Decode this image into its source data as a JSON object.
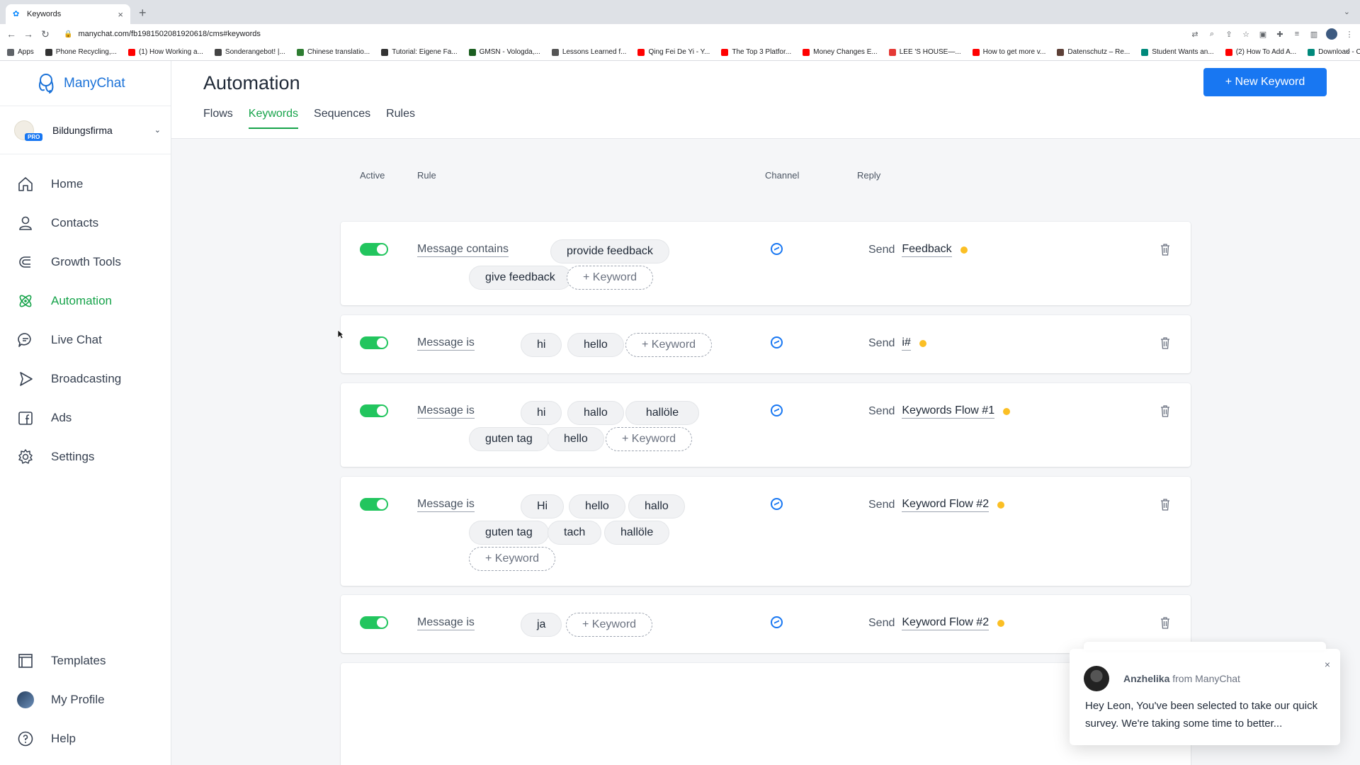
{
  "browser": {
    "tab_title": "Keywords",
    "url": "manychat.com/fb198150208192061​8/cms#keywords",
    "bookmarks": [
      {
        "label": "Apps",
        "color": "#5f6368"
      },
      {
        "label": "Phone Recycling,...",
        "color": "#333333"
      },
      {
        "label": "(1) How Working a...",
        "color": "#ff0000"
      },
      {
        "label": "Sonderangebot! |...",
        "color": "#444444"
      },
      {
        "label": "Chinese translatio...",
        "color": "#2e7d32"
      },
      {
        "label": "Tutorial: Eigene Fa...",
        "color": "#333333"
      },
      {
        "label": "GMSN - Vologda,...",
        "color": "#1b5e20"
      },
      {
        "label": "Lessons Learned f...",
        "color": "#555555"
      },
      {
        "label": "Qing Fei De Yi - Y...",
        "color": "#ff0000"
      },
      {
        "label": "The Top 3 Platfor...",
        "color": "#ff0000"
      },
      {
        "label": "Money Changes E...",
        "color": "#ff0000"
      },
      {
        "label": "LEE 'S HOUSE—...",
        "color": "#e53935"
      },
      {
        "label": "How to get more v...",
        "color": "#ff0000"
      },
      {
        "label": "Datenschutz – Re...",
        "color": "#5d4037"
      },
      {
        "label": "Student Wants an...",
        "color": "#00897b"
      },
      {
        "label": "(2) How To Add A...",
        "color": "#ff0000"
      },
      {
        "label": "Download - Cooki...",
        "color": "#00897b"
      }
    ]
  },
  "brand": {
    "name": "ManyChat",
    "color": "#1b72d8"
  },
  "account": {
    "name": "Bildungsfirma",
    "badge": "PRO"
  },
  "nav": {
    "items": [
      {
        "label": "Home",
        "icon": "home-icon"
      },
      {
        "label": "Contacts",
        "icon": "user-icon"
      },
      {
        "label": "Growth Tools",
        "icon": "magnet-icon"
      },
      {
        "label": "Automation",
        "icon": "atom-icon",
        "active": true
      },
      {
        "label": "Live Chat",
        "icon": "chat-icon"
      },
      {
        "label": "Broadcasting",
        "icon": "send-icon"
      },
      {
        "label": "Ads",
        "icon": "facebook-icon"
      },
      {
        "label": "Settings",
        "icon": "gear-icon"
      }
    ],
    "bottom": [
      {
        "label": "Templates",
        "icon": "templates-icon"
      },
      {
        "label": "My Profile",
        "icon": "avatar"
      },
      {
        "label": "Help",
        "icon": "help-icon"
      }
    ]
  },
  "page": {
    "title": "Automation",
    "tabs": [
      "Flows",
      "Keywords",
      "Sequences",
      "Rules"
    ],
    "active_tab": "Keywords",
    "new_button": "+ New Keyword"
  },
  "columns": {
    "active": "Active",
    "rule": "Rule",
    "channel": "Channel",
    "reply": "Reply"
  },
  "rules": [
    {
      "condition": "Message contains",
      "keywords": [
        "provide feedback",
        "give feedback"
      ],
      "add_label": "+ Keyword",
      "reply_prefix": "Send",
      "flow": "Feedback",
      "active": true
    },
    {
      "condition": "Message is",
      "keywords": [
        "hi",
        "hello"
      ],
      "add_label": "+ Keyword",
      "reply_prefix": "Send",
      "flow": "i#",
      "active": true
    },
    {
      "condition": "Message is",
      "keywords": [
        "hi",
        "hallo",
        "hallöle",
        "guten tag",
        "hello"
      ],
      "add_label": "+ Keyword",
      "reply_prefix": "Send",
      "flow": "Keywords Flow #1",
      "active": true
    },
    {
      "condition": "Message is",
      "keywords": [
        "Hi",
        "hello",
        "hallo",
        "guten tag",
        "tach",
        "hallöle"
      ],
      "add_label": "+ Keyword",
      "reply_prefix": "Send",
      "flow": "Keyword Flow #2",
      "active": true
    },
    {
      "condition": "Message is",
      "keywords": [
        "ja"
      ],
      "add_label": "+ Keyword",
      "reply_prefix": "Send",
      "flow": "Keyword Flow #2",
      "active": true
    }
  ],
  "chat_popup": {
    "sender": "Anzhelika",
    "from_text": "from ManyChat",
    "message": "Hey Leon,  You've been selected to take our quick survey. We're taking some time to better..."
  },
  "colors": {
    "accent_green": "#16a34a",
    "primary_blue": "#1877f2",
    "status_dot": "#fbbf24"
  }
}
